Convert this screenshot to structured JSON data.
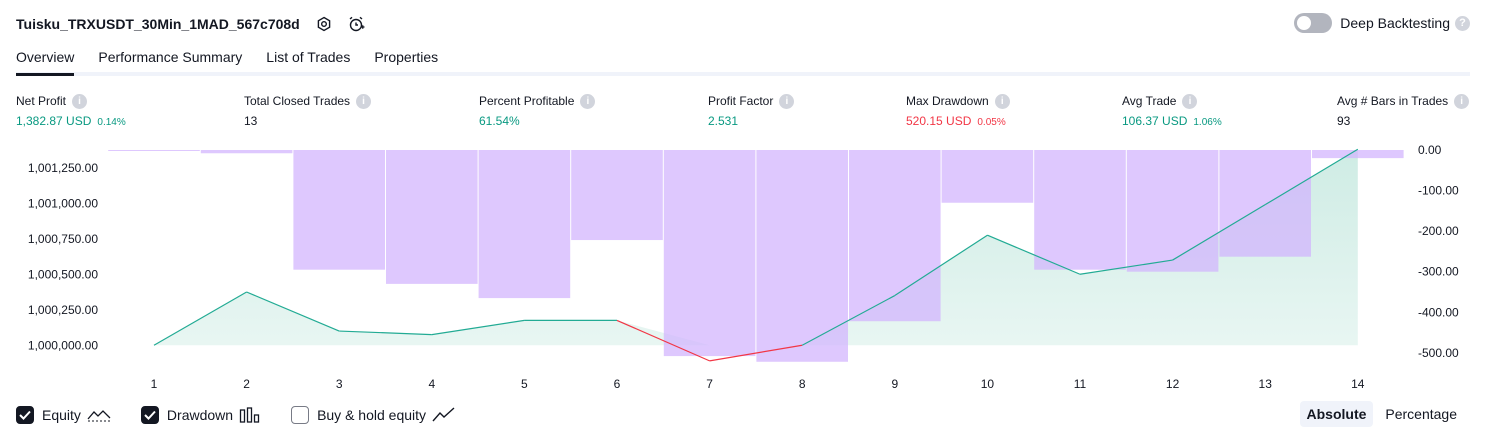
{
  "header": {
    "title": "Tuisku_TRXUSDT_30Min_1MAD_567c708d",
    "icons": [
      "settings-icon",
      "add-alert-icon"
    ]
  },
  "deep_backtesting": {
    "label": "Deep Backtesting",
    "enabled": false,
    "help": "?"
  },
  "tabs": [
    {
      "label": "Overview",
      "active": true
    },
    {
      "label": "Performance Summary",
      "active": false
    },
    {
      "label": "List of Trades",
      "active": false
    },
    {
      "label": "Properties",
      "active": false
    }
  ],
  "stats": [
    {
      "label": "Net Profit",
      "value": "1,382.87 USD",
      "pct": "0.14%",
      "tone": "pos",
      "help": "i"
    },
    {
      "label": "Total Closed Trades",
      "value": "13",
      "pct": "",
      "tone": "neu",
      "help": "i"
    },
    {
      "label": "Percent Profitable",
      "value": "61.54%",
      "pct": "",
      "tone": "pos",
      "help": "i"
    },
    {
      "label": "Profit Factor",
      "value": "2.531",
      "pct": "",
      "tone": "pos",
      "help": "i"
    },
    {
      "label": "Max Drawdown",
      "value": "520.15 USD",
      "pct": "0.05%",
      "tone": "neg",
      "help": "i"
    },
    {
      "label": "Avg Trade",
      "value": "106.37 USD",
      "pct": "1.06%",
      "tone": "pos",
      "help": "i"
    },
    {
      "label": "Avg # Bars in Trades",
      "value": "93",
      "pct": "",
      "tone": "neu",
      "help": "i"
    }
  ],
  "chart_data": {
    "type": "line",
    "x": [
      1,
      2,
      3,
      4,
      5,
      6,
      7,
      8,
      9,
      10,
      11,
      12,
      13,
      14
    ],
    "x_tick_labels": [
      "1",
      "2",
      "3",
      "4",
      "5",
      "6",
      "7",
      "8",
      "9",
      "10",
      "11",
      "12",
      "13",
      "14"
    ],
    "series": [
      {
        "name": "Equity",
        "axis": "left",
        "type": "area",
        "values": [
          1000000,
          1000375,
          1000100,
          1000075,
          1000175,
          1000175,
          999890,
          1000000,
          1000350,
          1000775,
          1000500,
          1000600,
          1000990,
          1001380
        ]
      },
      {
        "name": "Drawdown",
        "axis": "right",
        "type": "bar",
        "values": [
          -2,
          -8,
          -295,
          -330,
          -365,
          -222,
          -508,
          -522,
          -422,
          -130,
          -295,
          -300,
          -263,
          -20
        ]
      }
    ],
    "left_axis": {
      "ylim": [
        999875,
        1001375
      ],
      "ticks": [
        "1,001,250.00",
        "1,001,000.00",
        "1,000,750.00",
        "1,000,500.00",
        "1,000,250.00",
        "1,000,000.00"
      ]
    },
    "right_axis": {
      "ylim": [
        -525,
        0
      ],
      "ticks": [
        "0.00",
        "-100.00",
        "-200.00",
        "-300.00",
        "-400.00",
        "-500.00"
      ]
    },
    "colors": {
      "equity_up": "#22ab94",
      "equity_down": "#f23645",
      "equity_fill": "#ccebe3",
      "drawdown": "#d1b3fe"
    },
    "grid": false,
    "legend": "bottom-left"
  },
  "legend": {
    "items": [
      {
        "label": "Equity",
        "checked": true,
        "icon": "equity-line-icon"
      },
      {
        "label": "Drawdown",
        "checked": true,
        "icon": "drawdown-bars-icon"
      },
      {
        "label": "Buy & hold equity",
        "checked": false,
        "icon": "buy-hold-line-icon"
      }
    ]
  },
  "modes": [
    {
      "label": "Absolute",
      "active": true
    },
    {
      "label": "Percentage",
      "active": false
    }
  ]
}
